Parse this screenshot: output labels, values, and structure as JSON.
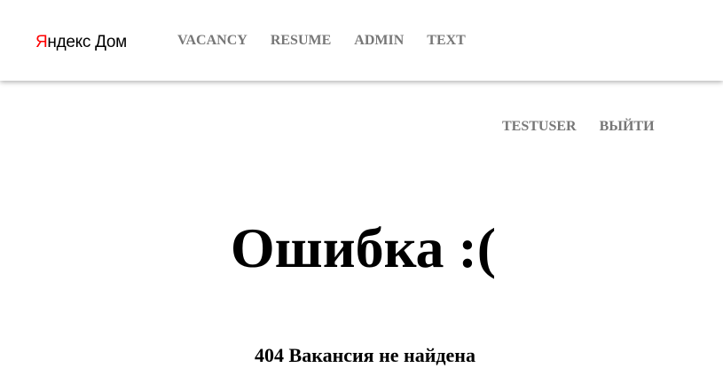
{
  "header": {
    "logo": {
      "first_letter": "Я",
      "rest": "ндекс",
      "suffix": "Дом"
    },
    "nav": [
      {
        "label": "VACANCY"
      },
      {
        "label": "RESUME"
      },
      {
        "label": "ADMIN"
      },
      {
        "label": "TEXT"
      }
    ]
  },
  "user_nav": {
    "username": "TESTUSER",
    "logout_label": "ВЫЙТИ"
  },
  "error": {
    "title": "Ошибка :(",
    "message": "404 Вакансия не найдена"
  },
  "colors": {
    "logo_accent": "#ff0000",
    "nav_text": "#777777",
    "body_text": "#000000",
    "background": "#ffffff"
  }
}
